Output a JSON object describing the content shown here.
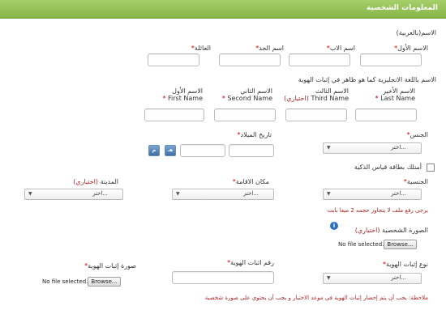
{
  "header": {
    "title": "المعلومات الشخصية"
  },
  "name_ar": {
    "section_label": "الاسم(بالعربية)",
    "first": "الاسم الأول",
    "father": "اسم الاب",
    "grandfather": "اسم الجد",
    "family": "العائلة"
  },
  "name_en": {
    "section_label": "الاسم باللغة الانجليزية كما هو ظاهر في إثبات الهوية",
    "last_ar": "الاسم الأخير",
    "last_en": "Last Name",
    "third_ar": "الاسم الثالث",
    "third_en": "Third Name",
    "optional": "(اختياري)",
    "second_ar": "الاسم الثاني",
    "second_en": "Second Name",
    "first_ar": "الاسم الأول",
    "first_en": "First Name"
  },
  "gender": {
    "label": "الجنس",
    "value": "اختر..."
  },
  "birth_date": {
    "label": "تاريخ الميلاد",
    "hijri_icon": "هـ",
    "gregorian_icon": "م"
  },
  "smart_card": {
    "label": "أمتلك بطاقة قياس الذكية"
  },
  "nationality": {
    "label": "الجنسية",
    "value": "اختر..."
  },
  "residence": {
    "label": "مكان الاقامة",
    "value": "اختر..."
  },
  "city": {
    "label": "المدينة",
    "optional": "(اختياري)",
    "value": "اختر..."
  },
  "upload_note": "يرجى رفع ملف لا يتجاوز حجمه 2 ميغا بايت",
  "photo": {
    "label": "الصورة الشخصية",
    "optional": "(اختياري)",
    "browse": "Browse...",
    "status": "No file selected."
  },
  "id_type": {
    "label": "نوع إثبات الهوية",
    "value": "اختر..."
  },
  "id_number": {
    "label": "رقم اثبات الهوية"
  },
  "id_image": {
    "label": "صورة إثبات الهوية",
    "browse": "Browse...",
    "status": "No file selected."
  },
  "footer_note": "ملاحظة: يجب أن يتم إحضار إثبات الهوية في موعد الاختبار و يجب أن يحتوي على صورة شخصية",
  "icons": {
    "info": "info-icon",
    "dropdown": "chevron-down-icon",
    "calendar": "calendar-icon"
  }
}
